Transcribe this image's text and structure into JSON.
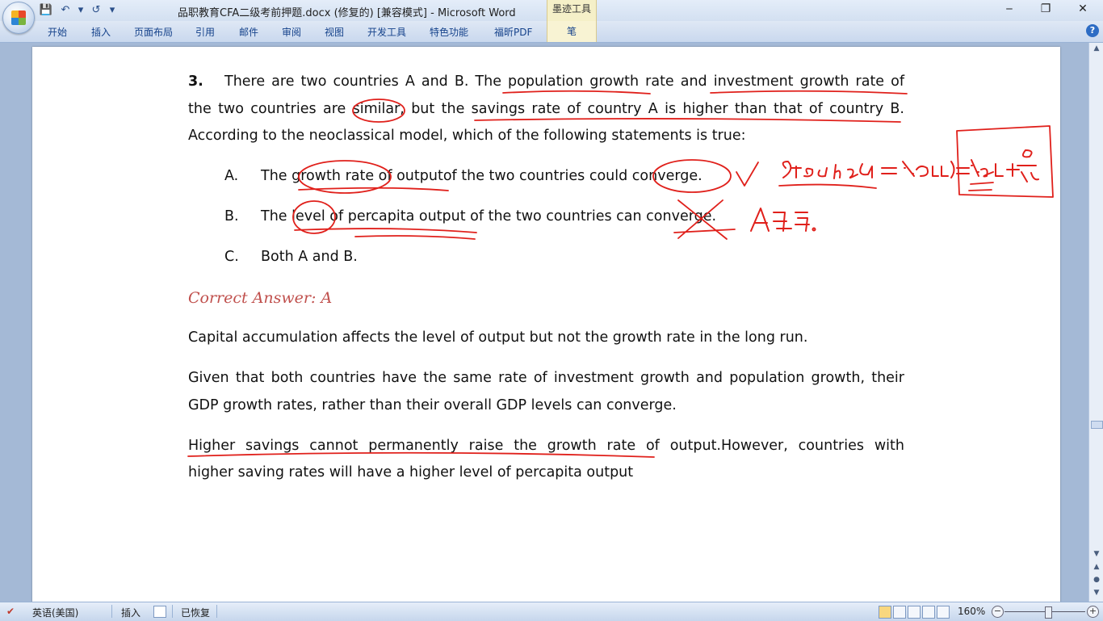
{
  "window": {
    "title": "品职教育CFA二级考前押题.docx (修复的) [兼容模式] - Microsoft Word",
    "context_tab_group": "墨迹工具",
    "controls": {
      "minimize": "‒",
      "restore": "❐",
      "close": "✕"
    }
  },
  "quick_access": {
    "save": "💾",
    "undo": "↶",
    "undo_dropdown": "▾",
    "redo": "↺",
    "customize": "▾"
  },
  "ribbon": {
    "tabs": [
      {
        "label": "开始"
      },
      {
        "label": "插入"
      },
      {
        "label": "页面布局"
      },
      {
        "label": "引用"
      },
      {
        "label": "邮件"
      },
      {
        "label": "审阅"
      },
      {
        "label": "视图"
      },
      {
        "label": "开发工具"
      },
      {
        "label": "特色功能"
      },
      {
        "label": "福昕PDF"
      }
    ],
    "context_tab": "笔",
    "help": "?"
  },
  "document": {
    "question": {
      "number": "3.",
      "line1": "There are two countries A and B. The population growth rate and investment growth rate of",
      "line2": "the two countries are similar, but the savings rate of country A is higher than that of country B.",
      "line3": "According to the neoclassical model, which of the following statements is true:"
    },
    "options": [
      {
        "letter": "A.",
        "text": "The growth rate of outputof the two countries could converge."
      },
      {
        "letter": "B.",
        "text": "The level of percapita output of the two countries can converge."
      },
      {
        "letter": "C.",
        "text": "Both A and B."
      }
    ],
    "answer_label": "Correct Answer: A",
    "explanation": [
      {
        "text": "Capital accumulation affects the level of output but not the growth rate in the long run."
      },
      {
        "line1": "Given that both countries have the same rate of investment growth and population growth, their",
        "line2": "GDP growth rates, rather than their overall GDP levels can converge."
      },
      {
        "line1": "Higher savings cannot permanently raise the growth rate of output.However, countries with",
        "line2": "higher saving rates will have a higher level of percapita output"
      }
    ]
  },
  "ink": {
    "color": "#e0201b",
    "steady_state_note": "Steady state = %Δ(y/l) = %ΔL + θ/(1−α)",
    "a_correct_note": "A正确."
  },
  "scrollbar": {
    "up": "▲",
    "down": "▼",
    "prev": "▲",
    "select": "●",
    "next": "▼"
  },
  "status": {
    "language": "英语(美国)",
    "mode": "插入",
    "recovered": "已恢复",
    "zoom": "160%",
    "zoom_out": "−",
    "zoom_in": "+"
  }
}
